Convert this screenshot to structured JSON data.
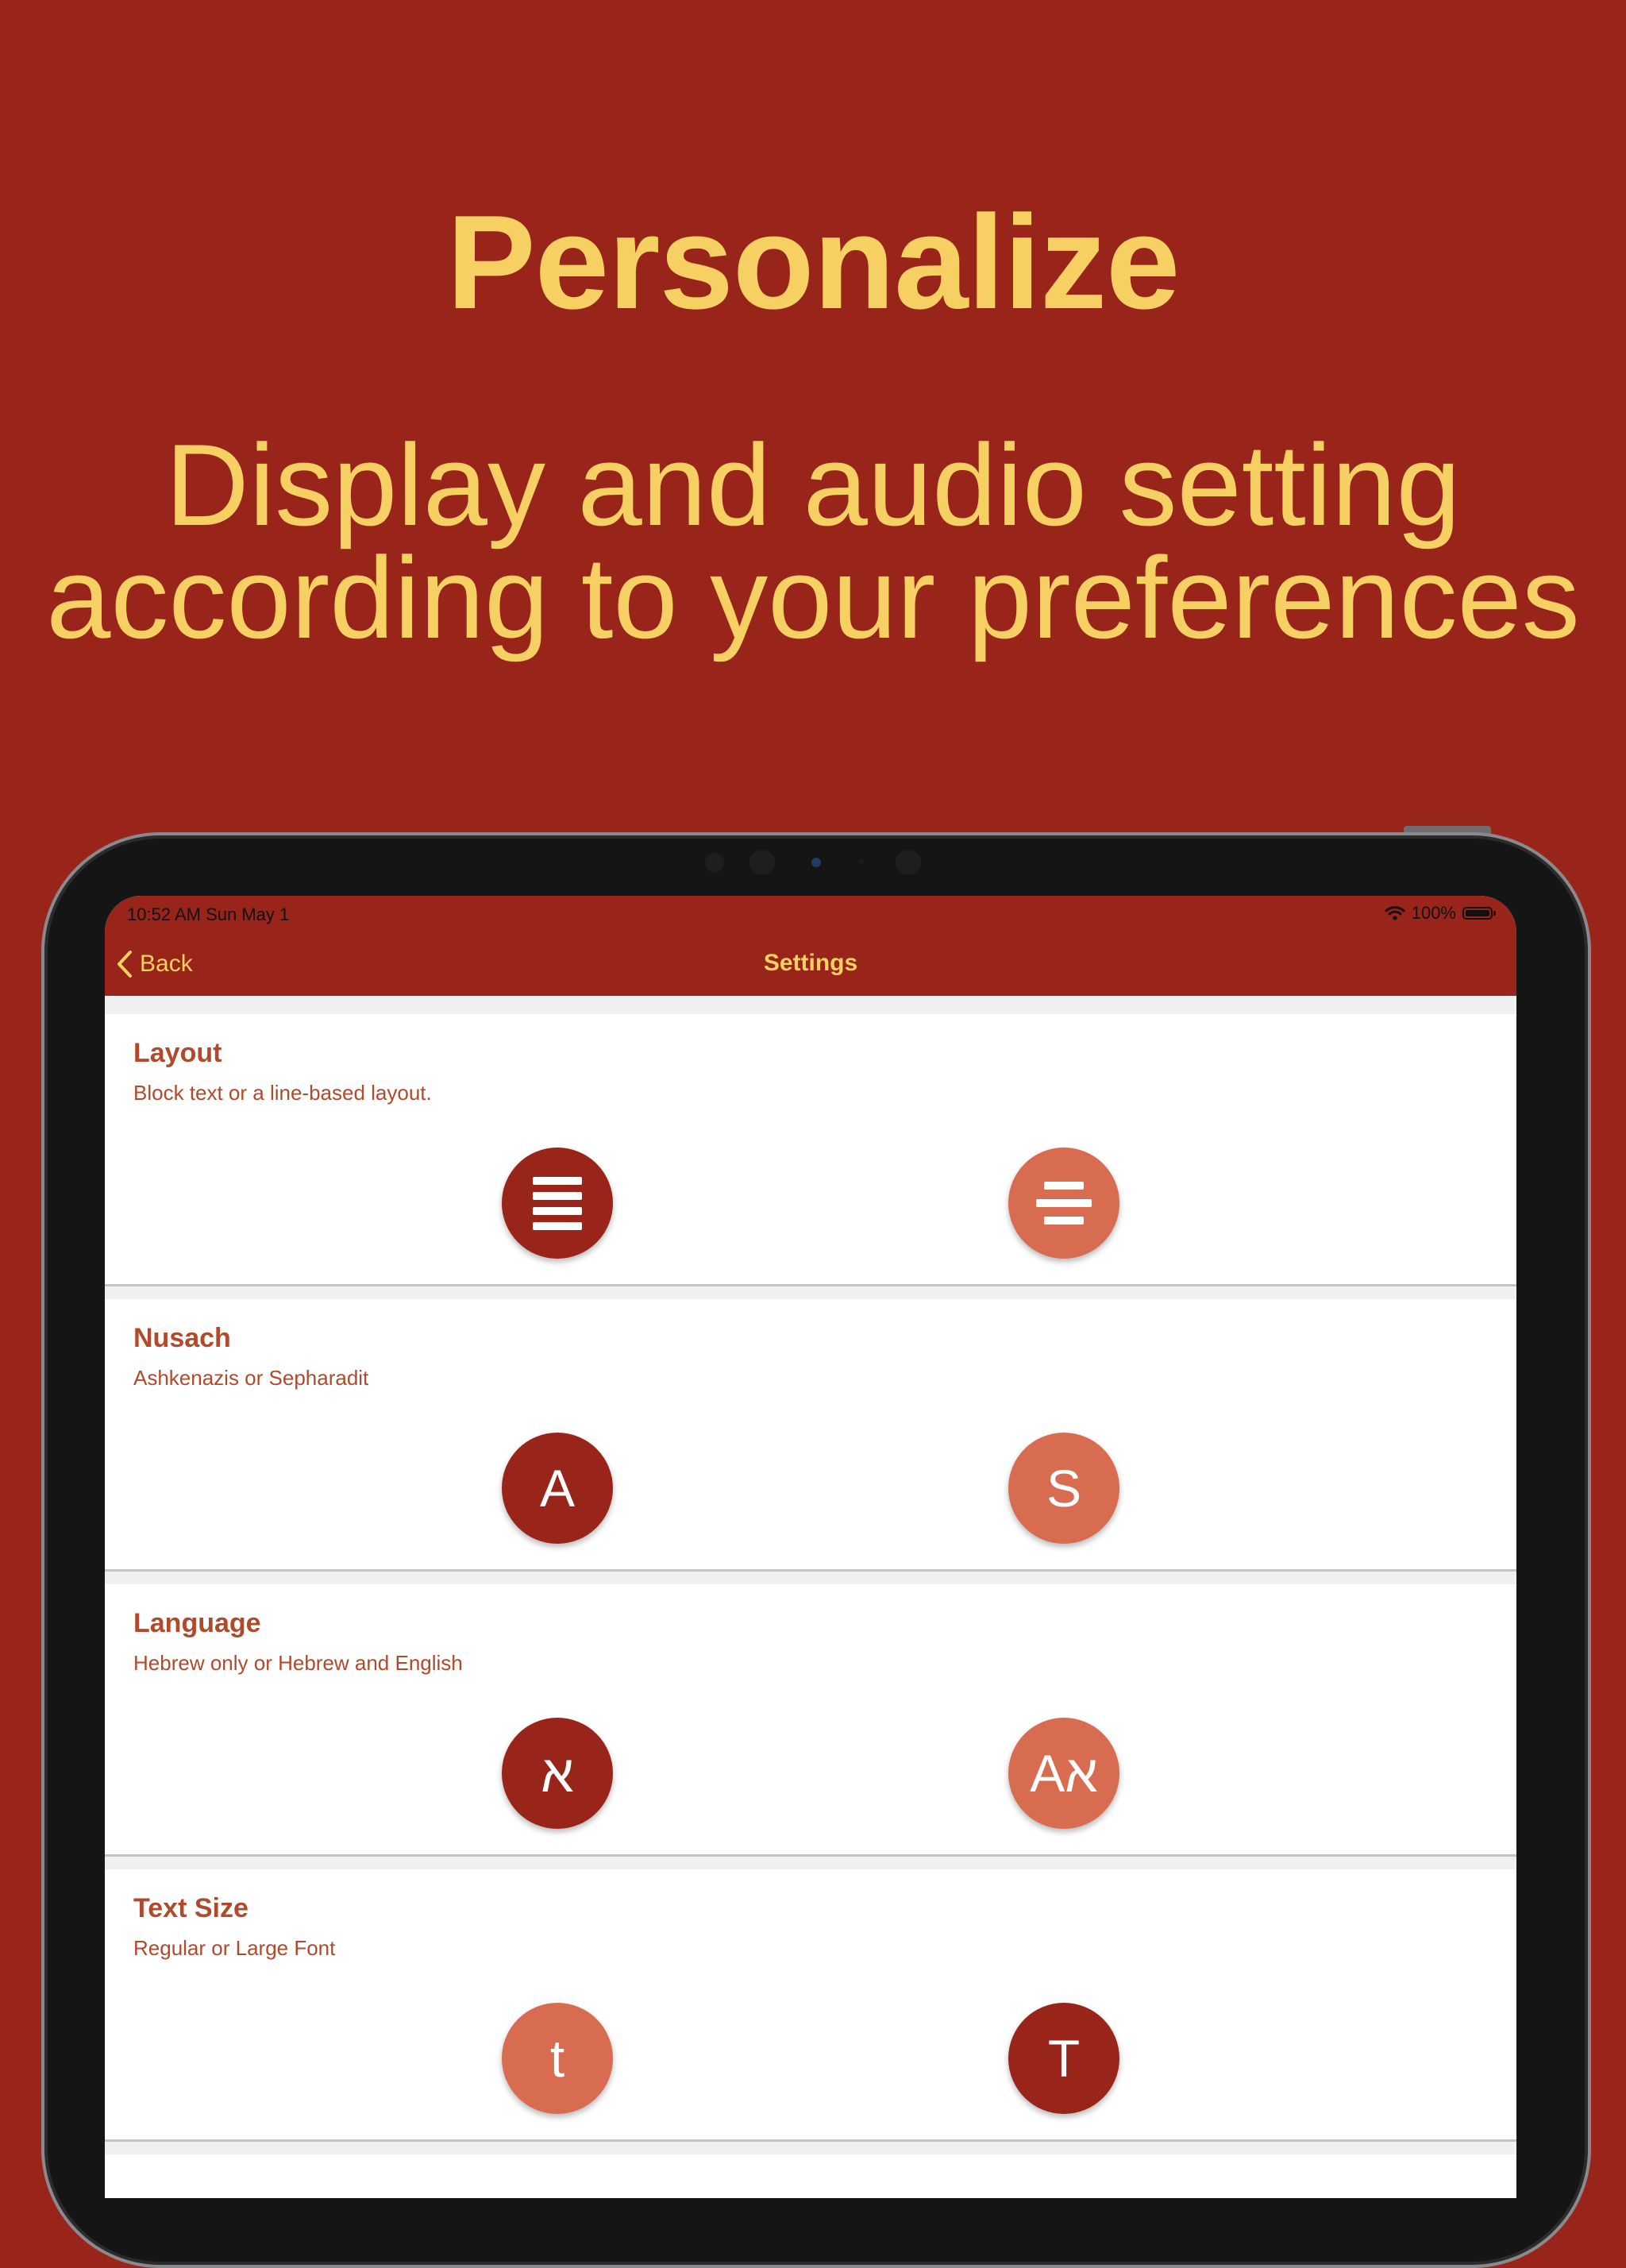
{
  "promo": {
    "headline": "Personalize",
    "subheadline": "Display and audio setting\naccording to your preferences"
  },
  "status_bar": {
    "time_date": "10:52 AM   Sun May 1",
    "battery_percent": "100%",
    "battery_level": 1.0
  },
  "nav": {
    "back_label": "Back",
    "title": "Settings"
  },
  "colors": {
    "background": "#98241a",
    "accent_yellow": "#f6d062",
    "selected_option": "#98241a",
    "unselected_option": "#d76c50",
    "section_text": "#b04a2c"
  },
  "sections": [
    {
      "title": "Layout",
      "subtitle": "Block text or a line-based layout.",
      "options": [
        {
          "icon": "justified-lines-icon",
          "label": "",
          "selected": true
        },
        {
          "icon": "centered-lines-icon",
          "label": "",
          "selected": false
        }
      ]
    },
    {
      "title": "Nusach",
      "subtitle": "Ashkenazis or Sepharadit",
      "options": [
        {
          "label": "A",
          "selected": true
        },
        {
          "label": "S",
          "selected": false
        }
      ]
    },
    {
      "title": "Language",
      "subtitle": "Hebrew only or Hebrew and English",
      "options": [
        {
          "label": "א",
          "selected": true
        },
        {
          "label": "Aא",
          "selected": false
        }
      ]
    },
    {
      "title": "Text Size",
      "subtitle": "Regular or Large Font",
      "options": [
        {
          "label": "t",
          "selected": false
        },
        {
          "label": "T",
          "selected": true
        }
      ]
    }
  ]
}
